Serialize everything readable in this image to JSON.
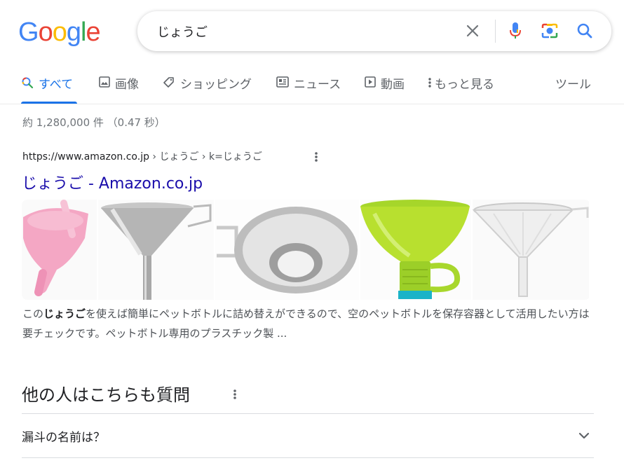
{
  "logo": {
    "letters": [
      "G",
      "o",
      "o",
      "g",
      "l",
      "e"
    ]
  },
  "search": {
    "query": "じょうご"
  },
  "tabs": [
    {
      "label": "すべて",
      "active": true,
      "icon": "search-icon"
    },
    {
      "label": "画像",
      "icon": "image-icon"
    },
    {
      "label": "ショッピング",
      "icon": "tag-icon"
    },
    {
      "label": "ニュース",
      "icon": "news-icon"
    },
    {
      "label": "動画",
      "icon": "play-icon"
    },
    {
      "label": "もっと見る",
      "icon": "more-vert-icon"
    },
    {
      "label": "ツール"
    }
  ],
  "stats": "約 1,280,000 件 （0.47 秒）",
  "result": {
    "url": "https://www.amazon.co.jp",
    "breadcrumb": " › じょうご › k=じょうご",
    "title": "じょうご - Amazon.co.jp",
    "snippet_pre": "この",
    "snippet_bold": "じょうご",
    "snippet_post": "を使えば簡単にペットボトルに詰め替えができるので、空のペットボトルを保存容器として活用したい方は要チェックです。ペットボトル専用のプラスチック製 ..."
  },
  "paa": {
    "title": "他の人はこちらも質問",
    "questions": [
      "漏斗の名前は？"
    ]
  },
  "colors": {
    "blue": "#4285f4",
    "red": "#ea4335",
    "yellow": "#fbbc05",
    "green": "#34a853",
    "link": "#1a0dab",
    "accent": "#1a73e8"
  }
}
